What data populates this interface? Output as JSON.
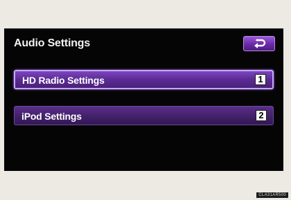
{
  "screen": {
    "title": "Audio Settings",
    "back_icon": "return-arrow-icon"
  },
  "menu": {
    "items": [
      {
        "label": "HD Radio Settings",
        "number": "1",
        "selected": true
      },
      {
        "label": "iPod Settings",
        "number": "2",
        "selected": false
      }
    ]
  },
  "figure_code": "CLA31AR500",
  "colors": {
    "accent": "#6a2aa8",
    "highlight_border": "#c9a6ff",
    "screen_bg": "#050506",
    "page_bg": "#edeae3"
  }
}
